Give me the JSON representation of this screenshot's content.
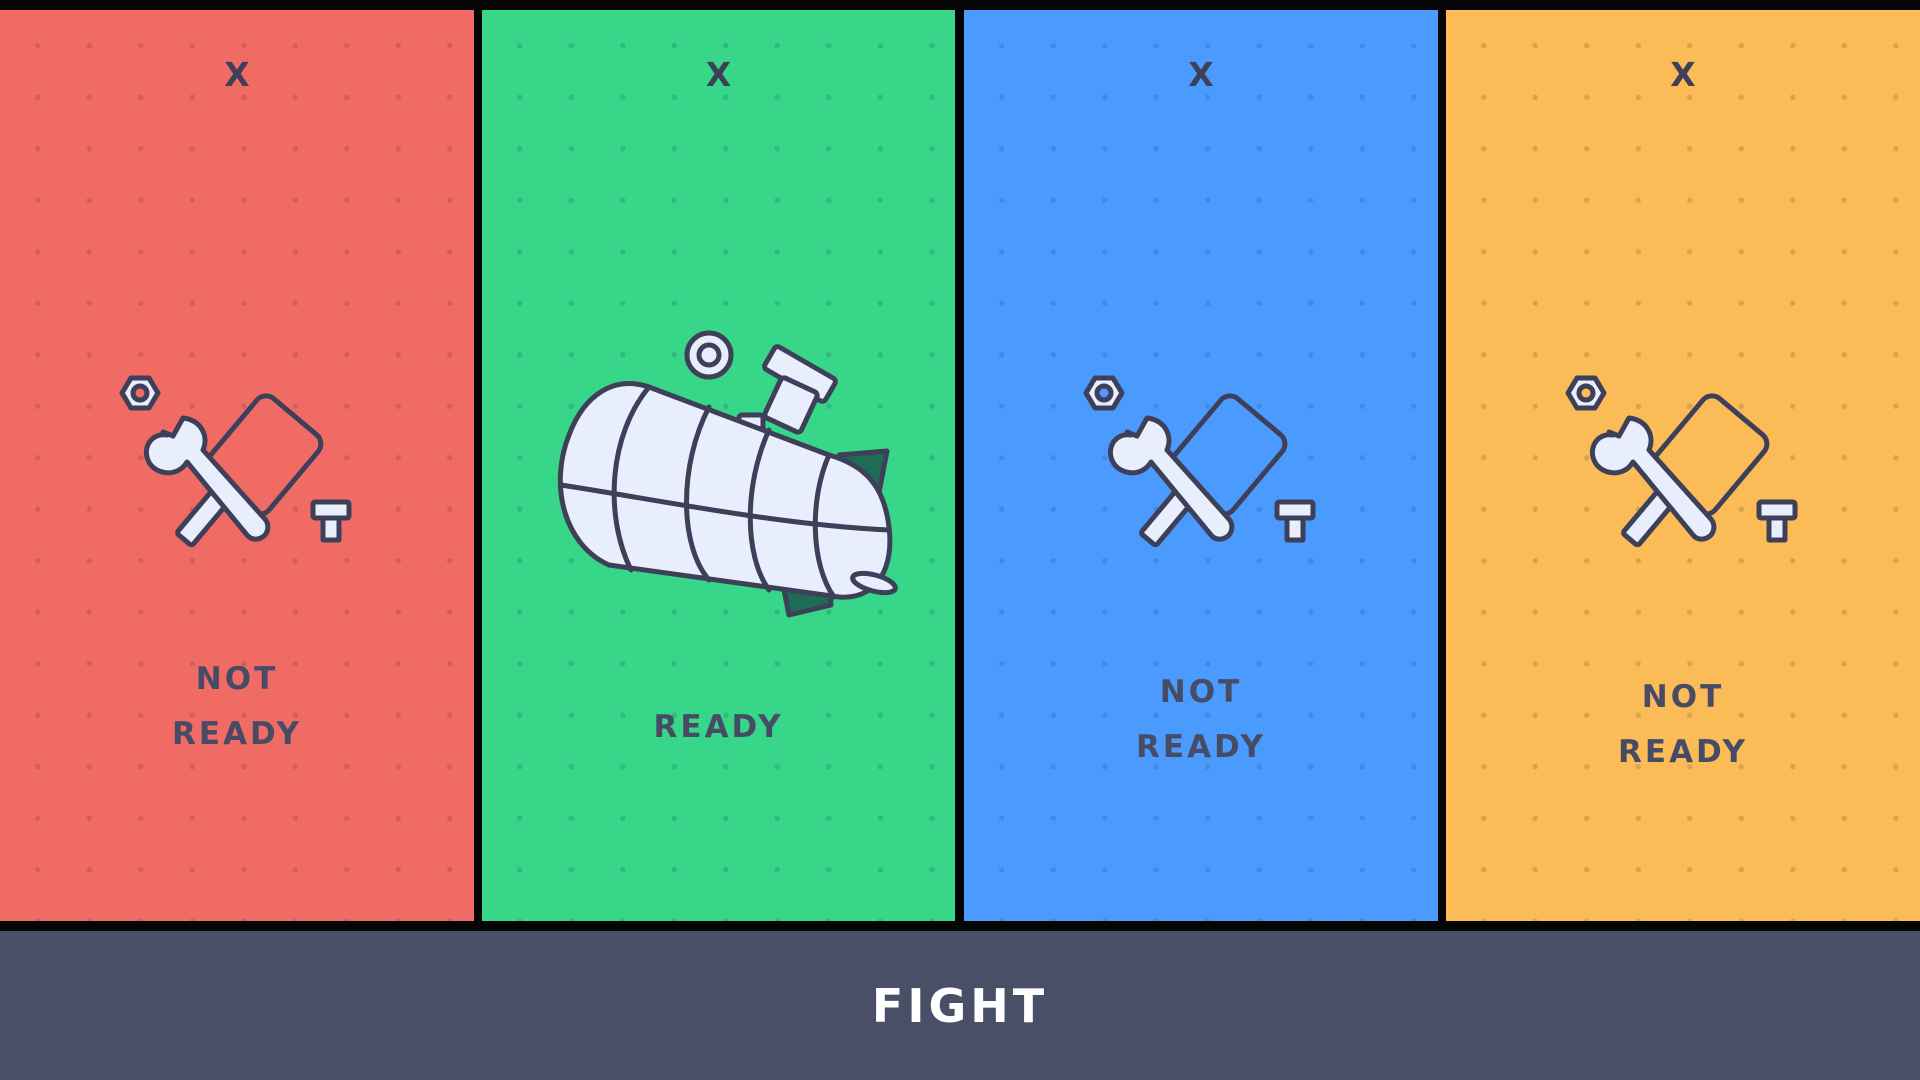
{
  "players": [
    {
      "close_label": "X",
      "status": "NOT\nREADY",
      "color": "#f06b63",
      "icon": "tools-icon"
    },
    {
      "close_label": "X",
      "status": "READY",
      "color": "#37d688",
      "icon": "rocket-ship-icon"
    },
    {
      "close_label": "X",
      "status": "NOT\nREADY",
      "color": "#4b9bff",
      "icon": "tools-icon"
    },
    {
      "close_label": "X",
      "status": "NOT\nREADY",
      "color": "#fbbc57",
      "icon": "tools-icon"
    }
  ],
  "fight_button": {
    "label": "FIGHT",
    "color": "#4a4f68"
  }
}
